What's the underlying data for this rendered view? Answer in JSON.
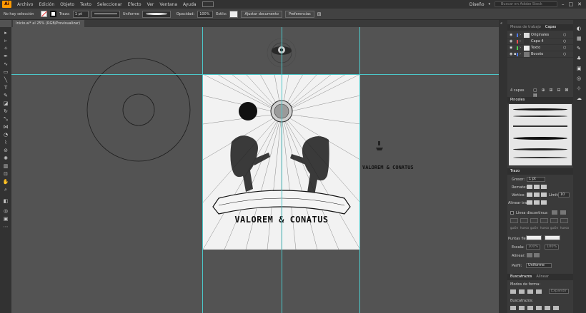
{
  "app": {
    "logo": "Ai"
  },
  "menu": [
    "Archivo",
    "Edición",
    "Objeto",
    "Texto",
    "Seleccionar",
    "Efecto",
    "Ver",
    "Ventana",
    "Ayuda"
  ],
  "menu_right": {
    "workspace": "Diseño",
    "search_placeholder": "Buscar en Adobe Stock"
  },
  "control": {
    "selection": "No hay selección",
    "stroke_label": "Trazo:",
    "stroke_value": "1 pt",
    "profile": "Uniforme",
    "opacity_label": "Opacidad:",
    "opacity_value": "100%",
    "style_label": "Estilo:",
    "doc_setup": "Ajustar documento",
    "preferences": "Preferencias"
  },
  "document_tab": "Inicio.ai* al 25% (RGB/Previsualizar)",
  "artwork": {
    "title": "VALOREM & CONATUS"
  },
  "canvas_text": "VALOREM & CONATUS",
  "panels": {
    "top_tabs": [
      "Mesas de trabajo",
      "Capas"
    ],
    "layers": [
      {
        "name": "Originales",
        "color": "#4f7bff"
      },
      {
        "name": "Capa 4",
        "color": "#ff4f4f"
      },
      {
        "name": "Texto",
        "color": "#4fd04f"
      },
      {
        "name": "Boceto",
        "color": "#4f7bff"
      }
    ],
    "layers_count": "4 capas",
    "brushes_tab": "Pinceles",
    "stroke_tab": "Trazo",
    "stroke": {
      "weight_label": "Grosor:",
      "weight_value": "1 pt",
      "cap_label": "Remate:",
      "corner_label": "Vértice:",
      "limit_label": "Límite:",
      "limit_value": "10",
      "align_label": "Alinear trazo:",
      "dashed_label": "Línea discontinua",
      "dash_labels": [
        "guión",
        "hueco",
        "guión",
        "hueco",
        "guión",
        "hueco"
      ],
      "arrow_label": "Puntas flecha:",
      "scale_label": "Escala:",
      "scale1": "100%",
      "scale2": "100%",
      "align_label2": "Alinear:",
      "profile_label": "Perfil:",
      "profile_value": "Uniforme"
    },
    "pathfinder_tabs": [
      "Buscatrazos",
      "Alinear"
    ],
    "shape_modes_label": "Modos de forma:",
    "expand_label": "Expandir",
    "pathfinders_label": "Buscatrazos:"
  }
}
